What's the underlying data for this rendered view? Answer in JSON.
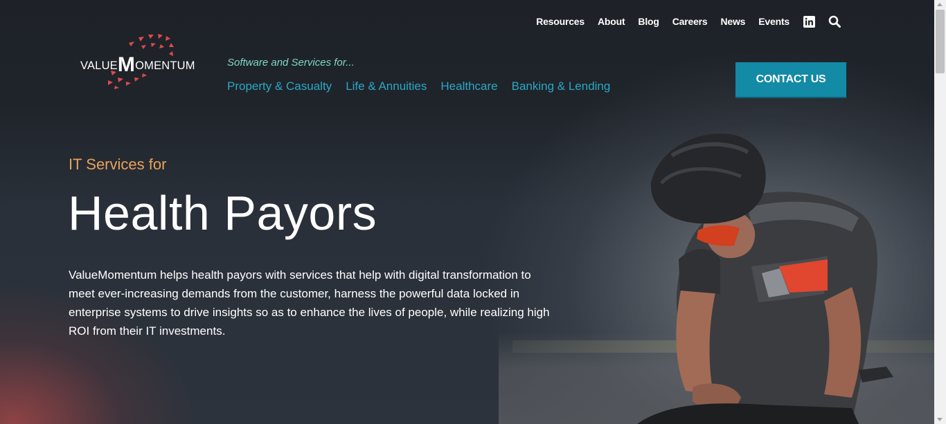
{
  "header": {
    "top_links": [
      "Resources",
      "About",
      "Blog",
      "Careers",
      "News",
      "Events"
    ],
    "linkedin_icon": "linkedin-icon",
    "search_icon": "search-icon",
    "logo": {
      "prefix": "VALUE",
      "m": "M",
      "suffix": "OMENTUM"
    },
    "tagline": "Software and Services for...",
    "main_links": [
      "Property & Casualty",
      "Life & Annuities",
      "Healthcare",
      "Banking & Lending"
    ],
    "contact_label": "CONTACT US"
  },
  "hero": {
    "eyebrow": "IT Services for",
    "title": "Health Payors",
    "description": "ValueMomentum helps health payors with services that help with digital transformation to meet ever-increasing demands from the customer, harness the powerful data locked in enterprise systems to drive insights so as to enhance the lives of people, while realizing high ROI from their IT investments."
  },
  "colors": {
    "accent_teal": "#138aa6",
    "nav_link": "#2aa8c5",
    "tagline": "#7fd6c7",
    "eyebrow": "#e9a25a",
    "logo_red": "#e04a4a"
  }
}
